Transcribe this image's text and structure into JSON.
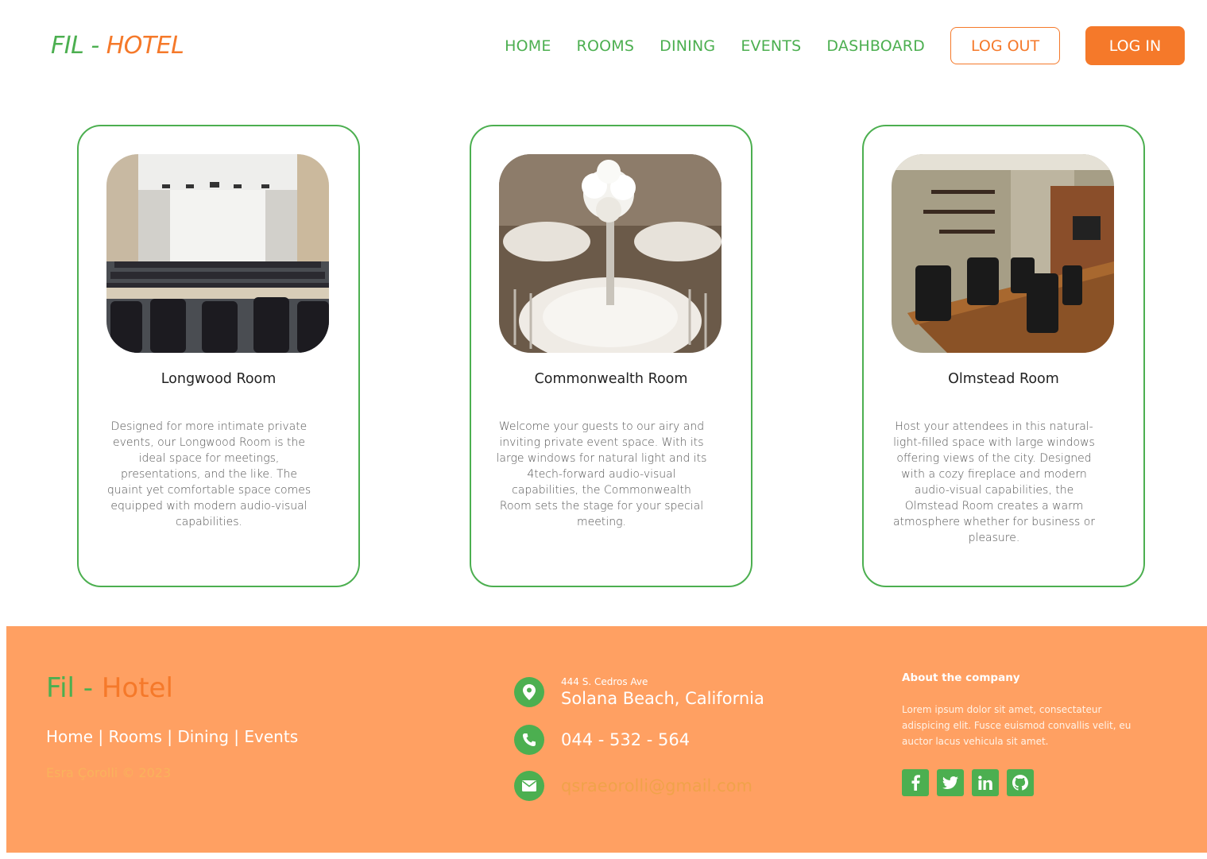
{
  "header": {
    "logo_part1": "FIL - ",
    "logo_part2": "HOTEL",
    "nav": [
      "HOME",
      "ROOMS",
      "DINING",
      "EVENTS",
      "DASHBOARD"
    ],
    "logout_label": "LOG OUT",
    "login_label": "LOG IN"
  },
  "rooms": [
    {
      "title": "Longwood Room",
      "description": "Designed for more intimate private events, our Longwood Room is the ideal space for meetings, presentations, and the like. The quaint yet comfortable space comes equipped with modern audio-visual capabilities."
    },
    {
      "title": "Commonwealth Room",
      "description": "Welcome your guests to our airy and inviting private event space. With its large windows for natural light and its 4tech-forward audio-visual capabilities, the Commonwealth Room sets the stage for your special meeting."
    },
    {
      "title": "Olmstead Room",
      "description": "Host your attendees in this natural-light-filled space with large windows offering views of the city. Designed with a cozy fireplace and modern audio-visual capabilities, the Olmstead Room creates a warm atmosphere whether for business or pleasure."
    }
  ],
  "footer": {
    "logo_part1": "Fil - ",
    "logo_part2": "Hotel",
    "links": [
      "Home",
      "Rooms",
      "Dining",
      "Events"
    ],
    "separator": "|",
    "copyright": "Esra Çorolli © 2023",
    "address_line1": "444 S. Cedros Ave",
    "address_line2": "Solana Beach, California",
    "phone": "044 - 532 - 564",
    "email": "qsraeorolli@gmail.com",
    "about_title": "About the company",
    "about_text": "Lorem ipsum dolor sit amet, consectateur adispicing elit. Fusce euismod convallis velit, eu auctor lacus vehicula sit amet.",
    "socials": [
      "facebook-icon",
      "twitter-icon",
      "linkedin-icon",
      "github-icon"
    ]
  },
  "colors": {
    "green": "#4caf50",
    "orange": "#f5792a",
    "footer_bg": "#ffa062"
  }
}
